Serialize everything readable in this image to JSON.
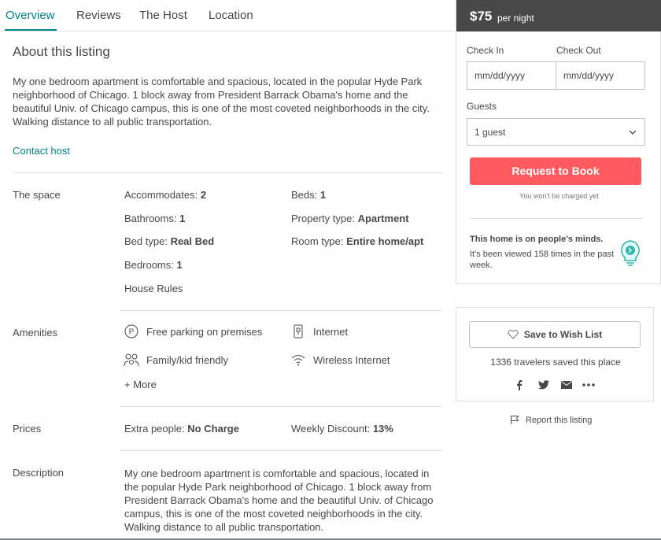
{
  "tabs": [
    "Overview",
    "Reviews",
    "The Host",
    "Location"
  ],
  "about": {
    "title": "About this listing",
    "text": "My one bedroom apartment is comfortable and spacious, located in the popular Hyde Park neighborhood of Chicago. 1 block away from President Barrack Obama's home and the beautiful Univ. of Chicago campus, this is one of the most coveted neighborhoods in the city. Walking distance to all public transportation.",
    "contact_link": "Contact host"
  },
  "space": {
    "label": "The space",
    "items": [
      {
        "key": "Accommodates:",
        "value": "2"
      },
      {
        "key": "Beds:",
        "value": "1"
      },
      {
        "key": "Bathrooms:",
        "value": "1"
      },
      {
        "key": "Property type:",
        "value": "Apartment"
      },
      {
        "key": "Bed type:",
        "value": "Real Bed"
      },
      {
        "key": "Room type:",
        "value": "Entire home/apt"
      },
      {
        "key": "Bedrooms:",
        "value": "1"
      }
    ],
    "house_rules_link": "House Rules"
  },
  "amenities": {
    "label": "Amenities",
    "items": [
      {
        "icon": "parking-icon",
        "label": "Free parking on premises"
      },
      {
        "icon": "internet-icon",
        "label": "Internet"
      },
      {
        "icon": "family-icon",
        "label": "Family/kid friendly"
      },
      {
        "icon": "wifi-icon",
        "label": "Wireless Internet"
      }
    ],
    "more_link": "+ More"
  },
  "prices": {
    "label": "Prices",
    "items": [
      {
        "key": "Extra people:",
        "value": "No Charge"
      },
      {
        "key": "Weekly Discount:",
        "value": "13%"
      }
    ]
  },
  "description": {
    "label": "Description",
    "text": "My one bedroom apartment is comfortable and spacious, located in the popular Hyde Park neighborhood of Chicago. 1 block away from President Barrack Obama's home and the beautiful Univ. of Chicago campus, this is one of the most coveted neighborhoods in the city. Walking distance to all public transportation."
  },
  "booking": {
    "price": "$75",
    "per_night": "per night",
    "check_in_label": "Check In",
    "check_out_label": "Check Out",
    "check_in_placeholder": "mm/dd/yyyy",
    "check_out_placeholder": "mm/dd/yyyy",
    "guests_label": "Guests",
    "guests_value": "1 guest",
    "book_button": "Request to Book",
    "not_charged": "You won't be charged yet",
    "minds_title": "This home is on people's minds.",
    "minds_sub": "It's been viewed 158 times in the past week."
  },
  "wish": {
    "button": "Save to Wish List",
    "saved_count": "1336 travelers saved this place",
    "share_icons": [
      "facebook-icon",
      "twitter-icon",
      "email-icon",
      "more-icon"
    ]
  },
  "report_link": "Report this listing",
  "colors": {
    "accent": "#008489",
    "book_button": "#ff5a5f",
    "header_dark": "#484848"
  }
}
